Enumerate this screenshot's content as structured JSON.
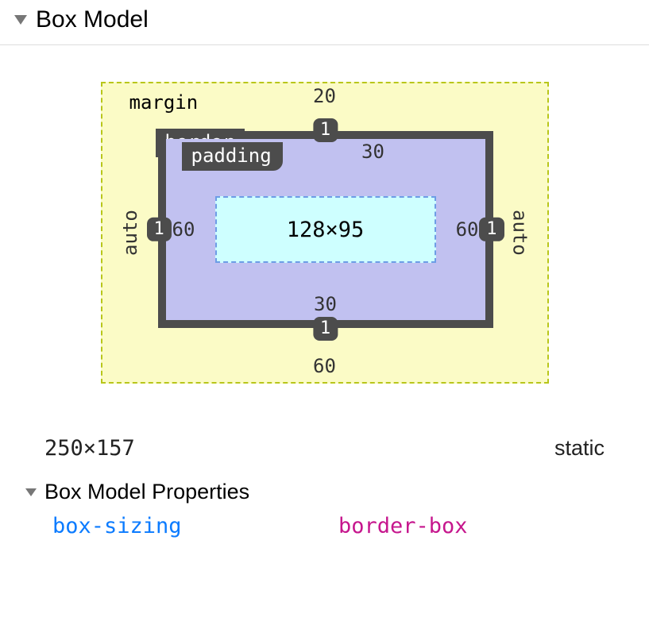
{
  "section_title": "Box Model",
  "labels": {
    "margin": "margin",
    "border": "border",
    "padding": "padding"
  },
  "margin": {
    "top": "20",
    "right": "auto",
    "bottom": "60",
    "left": "auto"
  },
  "border": {
    "top": "1",
    "right": "1",
    "bottom": "1",
    "left": "1"
  },
  "padding": {
    "top": "30",
    "right": "60",
    "bottom": "30",
    "left": "60"
  },
  "content_size": "128×95",
  "rendered_size": "250×157",
  "position_type": "static",
  "subsection_title": "Box Model Properties",
  "properties": [
    {
      "name": "box-sizing",
      "value": "border-box"
    }
  ]
}
